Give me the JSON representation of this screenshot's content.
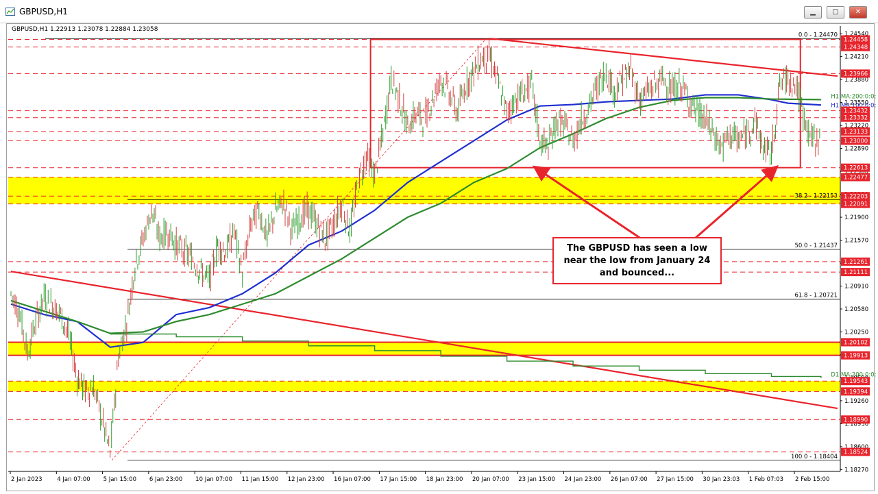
{
  "window": {
    "title": "GBPUSD,H1",
    "controls": {
      "minimize": "▁",
      "maximize": "▢",
      "close": "✕"
    }
  },
  "symbol_info": "GBPUSD,H1  1.22913 1.23078 1.22884 1.23058",
  "callout": {
    "lines": [
      "The GBPUSD has seen a low",
      "near the low from January 24",
      "and bounced..."
    ]
  },
  "colors": {
    "bull_candle": "#2e9e2e",
    "bear_candle": "#d24040",
    "ma_100": "#1f2fd0",
    "ma_200_h1": "#2e8b2e",
    "ma_200_d1": "#2e8b2e",
    "level_red": "#e8242c",
    "zone_yellow": "#ffff00",
    "label_bg_red": "#e8242c"
  },
  "chart_data": {
    "type": "candlestick",
    "symbol": "GBPUSD",
    "timeframe": "H1",
    "ylim": [
      1.18244,
      1.2465
    ],
    "grid": false,
    "x_labels": [
      "2 Jan 2023",
      "4 Jan 07:00",
      "5 Jan 15:00",
      "6 Jan 23:00",
      "10 Jan 07:00",
      "11 Jan 15:00",
      "12 Jan 23:00",
      "16 Jan 07:00",
      "17 Jan 15:00",
      "18 Jan 23:00",
      "20 Jan 07:00",
      "23 Jan 15:00",
      "24 Jan 23:00",
      "26 Jan 07:00",
      "27 Jan 15:00",
      "30 Jan 23:03",
      "1 Feb 07:03",
      "2 Feb 15:00"
    ],
    "y_ticks": [
      "1.24540",
      "1.24210",
      "1.23880",
      "1.23550",
      "1.23220",
      "1.22890",
      "1.22560",
      "1.22230",
      "1.21900",
      "1.21570",
      "1.21240",
      "1.20910",
      "1.20580",
      "1.20250",
      "1.19920",
      "1.19590",
      "1.19260",
      "1.18930",
      "1.18600",
      "1.18270"
    ],
    "price_path": [
      [
        0,
        1.208
      ],
      [
        1,
        1.2055
      ],
      [
        2,
        1.1995
      ],
      [
        3,
        1.204
      ],
      [
        4,
        1.2075
      ],
      [
        5,
        1.2065
      ],
      [
        6,
        1.205
      ],
      [
        7,
        1.202
      ],
      [
        8,
        1.196
      ],
      [
        9,
        1.194
      ],
      [
        10,
        1.1945
      ],
      [
        11,
        1.19
      ],
      [
        12,
        1.185
      ],
      [
        13,
        1.199
      ],
      [
        14,
        1.204
      ],
      [
        15,
        1.212
      ],
      [
        16,
        1.216
      ],
      [
        17,
        1.22
      ],
      [
        18,
        1.216
      ],
      [
        19,
        1.217
      ],
      [
        20,
        1.215
      ],
      [
        21,
        1.214
      ],
      [
        22,
        1.213
      ],
      [
        23,
        1.211
      ],
      [
        24,
        1.21
      ],
      [
        25,
        1.215
      ],
      [
        26,
        1.214
      ],
      [
        27,
        1.217
      ],
      [
        28,
        1.211
      ],
      [
        29,
        1.218
      ],
      [
        30,
        1.22
      ],
      [
        31,
        1.216
      ],
      [
        32,
        1.22
      ],
      [
        33,
        1.221
      ],
      [
        34,
        1.217
      ],
      [
        35,
        1.219
      ],
      [
        36,
        1.22
      ],
      [
        37,
        1.218
      ],
      [
        38,
        1.216
      ],
      [
        39,
        1.218
      ],
      [
        40,
        1.221
      ],
      [
        41,
        1.217
      ],
      [
        42,
        1.224
      ],
      [
        43,
        1.228
      ],
      [
        44,
        1.225
      ],
      [
        45,
        1.231
      ],
      [
        46,
        1.239
      ],
      [
        47,
        1.236
      ],
      [
        48,
        1.232
      ],
      [
        49,
        1.234
      ],
      [
        50,
        1.233
      ],
      [
        51,
        1.236
      ],
      [
        52,
        1.239
      ],
      [
        53,
        1.237
      ],
      [
        54,
        1.234
      ],
      [
        55,
        1.238
      ],
      [
        56,
        1.24
      ],
      [
        57,
        1.242
      ],
      [
        58,
        1.242
      ],
      [
        59,
        1.238
      ],
      [
        60,
        1.234
      ],
      [
        61,
        1.236
      ],
      [
        62,
        1.237
      ],
      [
        63,
        1.238
      ],
      [
        64,
        1.23
      ],
      [
        65,
        1.229
      ],
      [
        66,
        1.233
      ],
      [
        67,
        1.232
      ],
      [
        68,
        1.23
      ],
      [
        69,
        1.233
      ],
      [
        70,
        1.235
      ],
      [
        71,
        1.238
      ],
      [
        72,
        1.24
      ],
      [
        73,
        1.237
      ],
      [
        74,
        1.239
      ],
      [
        75,
        1.24
      ],
      [
        76,
        1.236
      ],
      [
        77,
        1.237
      ],
      [
        78,
        1.238
      ],
      [
        79,
        1.239
      ],
      [
        80,
        1.237
      ],
      [
        81,
        1.238
      ],
      [
        82,
        1.236
      ],
      [
        83,
        1.234
      ],
      [
        84,
        1.233
      ],
      [
        85,
        1.231
      ],
      [
        86,
        1.229
      ],
      [
        87,
        1.231
      ],
      [
        88,
        1.23
      ],
      [
        89,
        1.231
      ],
      [
        90,
        1.233
      ],
      [
        91,
        1.229
      ],
      [
        92,
        1.228
      ],
      [
        93,
        1.238
      ],
      [
        94,
        1.239
      ],
      [
        95,
        1.238
      ],
      [
        96,
        1.233
      ],
      [
        97,
        1.23
      ],
      [
        98,
        1.2306
      ]
    ],
    "moving_averages": [
      {
        "name": "H1 MA:100:0:0: 1.23514",
        "label": "H1 MA:100:0:0: 1.23514",
        "color": "#1f2fd0",
        "points": [
          [
            0,
            1.2065
          ],
          [
            4,
            1.205
          ],
          [
            8,
            1.204
          ],
          [
            12,
            1.2003
          ],
          [
            16,
            1.201
          ],
          [
            20,
            1.205
          ],
          [
            24,
            1.206
          ],
          [
            28,
            1.208
          ],
          [
            32,
            1.211
          ],
          [
            36,
            1.215
          ],
          [
            40,
            1.217
          ],
          [
            44,
            1.22
          ],
          [
            48,
            1.224
          ],
          [
            52,
            1.227
          ],
          [
            56,
            1.23
          ],
          [
            60,
            1.233
          ],
          [
            64,
            1.235
          ],
          [
            68,
            1.2352
          ],
          [
            72,
            1.2356
          ],
          [
            76,
            1.2358
          ],
          [
            80,
            1.236
          ],
          [
            84,
            1.2366
          ],
          [
            88,
            1.2366
          ],
          [
            92,
            1.2359
          ],
          [
            94,
            1.2354
          ],
          [
            98,
            1.23514
          ]
        ]
      },
      {
        "name": "H1 MA:200:0:0: 1.23592",
        "label": "H1 MA:200:0:0: 1.23592",
        "color": "#2e8b2e",
        "points": [
          [
            0,
            1.207
          ],
          [
            4,
            1.2055
          ],
          [
            8,
            1.204
          ],
          [
            12,
            1.2023
          ],
          [
            16,
            1.2025
          ],
          [
            20,
            1.204
          ],
          [
            24,
            1.205
          ],
          [
            28,
            1.2065
          ],
          [
            32,
            1.208
          ],
          [
            36,
            1.2105
          ],
          [
            40,
            1.213
          ],
          [
            44,
            1.216
          ],
          [
            48,
            1.219
          ],
          [
            52,
            1.221
          ],
          [
            56,
            1.224
          ],
          [
            60,
            1.226
          ],
          [
            64,
            1.229
          ],
          [
            68,
            1.231
          ],
          [
            72,
            1.2332
          ],
          [
            76,
            1.2348
          ],
          [
            80,
            1.2358
          ],
          [
            84,
            1.2362
          ],
          [
            88,
            1.2362
          ],
          [
            92,
            1.236
          ],
          [
            98,
            1.23592
          ]
        ]
      },
      {
        "name": "D1 MA:200:0:0: 1.19587",
        "label": "D1 MA:200:0:0: 1.19587",
        "color": "#2e8b2e",
        "points": [
          [
            12,
            1.2022
          ],
          [
            20,
            1.2018
          ],
          [
            28,
            1.2012
          ],
          [
            36,
            1.2005
          ],
          [
            44,
            1.1998
          ],
          [
            52,
            1.199
          ],
          [
            60,
            1.1983
          ],
          [
            68,
            1.1976
          ],
          [
            76,
            1.197
          ],
          [
            84,
            1.1965
          ],
          [
            92,
            1.1961
          ],
          [
            98,
            1.19587
          ]
        ]
      }
    ],
    "horizontal_levels": [
      {
        "value": 1.24458,
        "label": "1.24458",
        "style": "red-dashed"
      },
      {
        "value": 1.24348,
        "label": "1.24348",
        "style": "red-dashed"
      },
      {
        "value": 1.23966,
        "label": "1.23966",
        "style": "red-dashed"
      },
      {
        "value": 1.23432,
        "label": "1.23432",
        "style": "red-dashed"
      },
      {
        "value": 1.23332,
        "label": "1.23332",
        "style": "red-dashed"
      },
      {
        "value": 1.23133,
        "label": "1.23133",
        "style": "red-dashed"
      },
      {
        "value": 1.23,
        "label": "1.23000",
        "style": "red-dashed"
      },
      {
        "value": 1.22613,
        "label": "1.22613",
        "style": "red-dashed"
      },
      {
        "value": 1.22477,
        "label": "1.22477",
        "style": "red-dashed"
      },
      {
        "value": 1.22203,
        "label": "1.22203",
        "style": "red-dashed"
      },
      {
        "value": 1.22091,
        "label": "1.22091",
        "style": "red-dashed"
      },
      {
        "value": 1.21261,
        "label": "1.21261",
        "style": "red-dashed"
      },
      {
        "value": 1.21111,
        "label": "1.21111",
        "style": "red-dashed"
      },
      {
        "value": 1.20102,
        "label": "1.20102",
        "style": "red-solid"
      },
      {
        "value": 1.19913,
        "label": "1.19913",
        "style": "red-solid"
      },
      {
        "value": 1.19543,
        "label": "1.19543",
        "style": "red-dashed"
      },
      {
        "value": 1.19394,
        "label": "1.19394",
        "style": "red-dashed"
      },
      {
        "value": 1.1899,
        "label": "1.18990",
        "style": "red-dashed"
      },
      {
        "value": 1.18524,
        "label": "1.18524",
        "style": "red-dashed"
      }
    ],
    "zones": [
      {
        "from": 1.22477,
        "to": 1.22091
      },
      {
        "from": 1.20102,
        "to": 1.19913
      },
      {
        "from": 1.19543,
        "to": 1.19394
      }
    ],
    "fibonacci": [
      {
        "value": 1.2447,
        "label": "0.0 - 1.24470"
      },
      {
        "value": 1.22153,
        "label": "38.2 - 1.22153"
      },
      {
        "value": 1.21437,
        "label": "50.0 - 1.21437"
      },
      {
        "value": 1.20721,
        "label": "61.8 - 1.20721"
      },
      {
        "value": 1.18404,
        "label": "100.0 - 1.18404"
      }
    ],
    "trendlines": [
      {
        "from": [
          0,
          1.2112
        ],
        "to": [
          100,
          1.1915
        ],
        "color": "#e8242c"
      },
      {
        "from": [
          58,
          1.2447
        ],
        "to": [
          100,
          1.2393
        ],
        "color": "#e8242c"
      }
    ],
    "range_box": {
      "x_from": 43.5,
      "x_to": 95.5,
      "top": 1.24458,
      "bottom": 1.22613
    },
    "annotation_arrows": [
      {
        "from": [
          76.5,
          1.2157
        ],
        "to": [
          63.5,
          1.2261
        ]
      },
      {
        "from": [
          82.5,
          1.2157
        ],
        "to": [
          92.5,
          1.2261
        ]
      }
    ]
  }
}
